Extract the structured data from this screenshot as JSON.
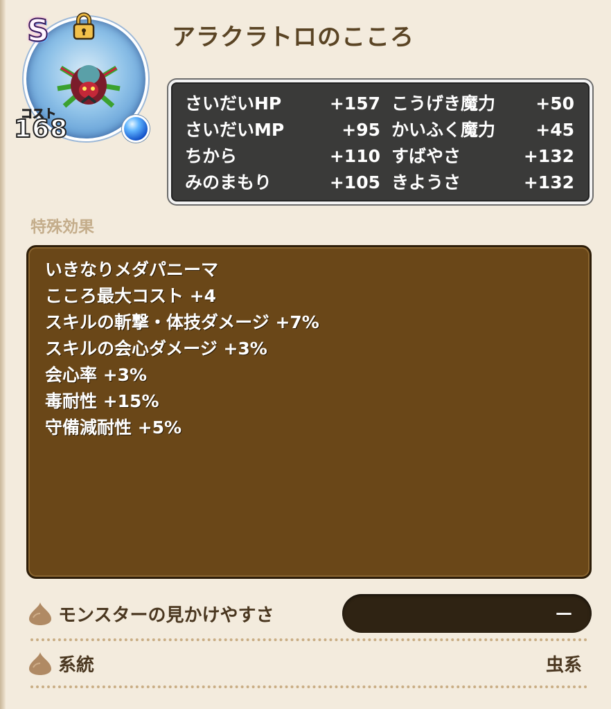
{
  "header": {
    "title": "アラクラトロのこころ",
    "rank": "S",
    "cost_label": "コスト",
    "cost_value": "168"
  },
  "stats": [
    {
      "left_name": "さいだいHP",
      "left_value": "+157",
      "right_name": "こうげき魔力",
      "right_value": "+50"
    },
    {
      "left_name": "さいだいMP",
      "left_value": "+95",
      "right_name": "かいふく魔力",
      "right_value": "+45"
    },
    {
      "left_name": "ちから",
      "left_value": "+110",
      "right_name": "すばやさ",
      "right_value": "+132"
    },
    {
      "left_name": "みのまもり",
      "left_value": "+105",
      "right_name": "きようさ",
      "right_value": "+132"
    }
  ],
  "special": {
    "label": "特殊効果",
    "effects": [
      "いきなりメダパニーマ",
      "こころ最大コスト +4",
      "スキルの斬撃・体技ダメージ +7%",
      "スキルの会心ダメージ +3%",
      "会心率 +3%",
      "毒耐性 +15%",
      "守備減耐性 +5%"
    ]
  },
  "info": {
    "visibility_label": "モンスターの見かけやすさ",
    "visibility_value": "－",
    "family_label": "系統",
    "family_value": "虫系"
  },
  "colors": {
    "background": "#f3ebdd",
    "stats_bg": "#3a3a39",
    "effects_bg": "#6a4718",
    "title_text": "#5a4424"
  },
  "icons": {
    "rank": "rank-s-badge",
    "lock": "lock-icon",
    "orb": "blue-orb-icon",
    "bullet": "drop-bullet-icon"
  }
}
